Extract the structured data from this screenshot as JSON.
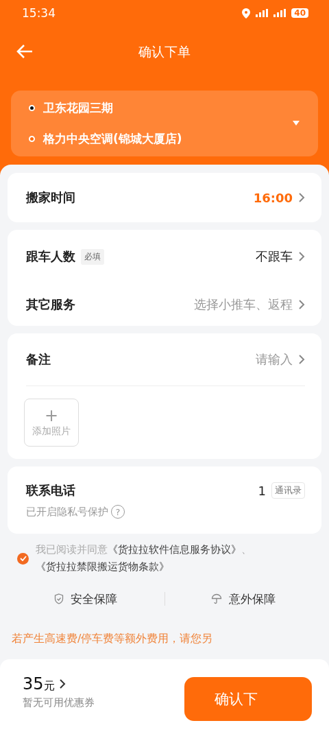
{
  "status_bar": {
    "time": "15:34",
    "battery": "40"
  },
  "header": {
    "title": "确认下单"
  },
  "route": {
    "stops": [
      {
        "name": "卫东花园三期",
        "kind": "start"
      },
      {
        "name": "格力中央空调(锦城大厦店)",
        "kind": "end"
      }
    ],
    "expanded": false
  },
  "time_row": {
    "label": "搬家时间",
    "value": "16:00"
  },
  "service_rows": [
    {
      "label": "跟车人数",
      "tag": "必填",
      "value": "不跟车",
      "kind": "chosen"
    },
    {
      "label": "其它服务",
      "value": "选择小推车、返程",
      "kind": "hint"
    }
  ],
  "note": {
    "label": "备注",
    "placeholder": "请输入",
    "add_photo": "添加照片",
    "add_icon": "+"
  },
  "contact": {
    "label": "联系电话",
    "value": "1",
    "button": "通讯录",
    "privacy": "已开启隐私号保护",
    "help": "?"
  },
  "agreement": {
    "checked": true,
    "text": "我已阅读并同意",
    "links": [
      "《货拉拉软件信息服务协议》",
      "《货拉拉禁限搬运货物条款》"
    ],
    "separator": "、"
  },
  "guarantees": [
    {
      "label": "安全保障",
      "kind": "shield"
    },
    {
      "label": "意外保障",
      "kind": "umbrella"
    }
  ],
  "notice": "若产生高速费/停车费等额外费用，请您另",
  "footer": {
    "price": "35",
    "unit": "元",
    "coupon": "暂无可用优惠券",
    "submit": "确认下"
  }
}
